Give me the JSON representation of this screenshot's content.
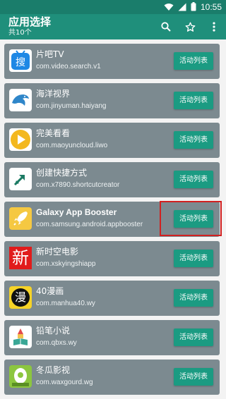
{
  "status_bar": {
    "time": "10:55",
    "icons": [
      "wifi-icon",
      "signal-icon",
      "battery-icon"
    ]
  },
  "app_bar": {
    "title": "应用选择",
    "subtitle": "共10个",
    "actions": [
      "search-icon",
      "star-icon",
      "more-vert-icon"
    ]
  },
  "colors": {
    "app_bar": "#1f8f7b",
    "status_bar": "#1a7d6b",
    "card": "#7c8a90",
    "button": "#1b9b82",
    "highlight": "#d12020"
  },
  "apps": [
    {
      "name": "片吧TV",
      "package": "com.video.search.v1",
      "button": "活动列表",
      "icon": "pianba-tv-icon"
    },
    {
      "name": "海洋视界",
      "package": "com.jinyuman.haiyang",
      "button": "活动列表",
      "icon": "dolphin-icon"
    },
    {
      "name": "完美看看",
      "package": "com.maoyuncloud.liwo",
      "button": "活动列表",
      "icon": "play-circle-icon"
    },
    {
      "name": "创建快捷方式",
      "package": "com.x7890.shortcutcreator",
      "button": "活动列表",
      "icon": "shortcut-arrow-icon"
    },
    {
      "name": "Galaxy App Booster",
      "package": "com.samsung.android.appbooster",
      "button": "活动列表",
      "icon": "rocket-icon"
    },
    {
      "name": "新时空电影",
      "package": "com.xskyingshiapp",
      "button": "活动列表",
      "icon": "xin-character-icon",
      "icon_text": "新"
    },
    {
      "name": "40漫画",
      "package": "com.manhua40.wy",
      "button": "活动列表",
      "icon": "manhua-comic-icon",
      "icon_text": "漫"
    },
    {
      "name": "铅笔小说",
      "package": "com.qbxs.wy",
      "button": "活动列表",
      "icon": "pencil-book-icon"
    },
    {
      "name": "冬瓜影视",
      "package": "com.waxgourd.wg",
      "button": "活动列表",
      "icon": "wax-gourd-icon"
    }
  ]
}
